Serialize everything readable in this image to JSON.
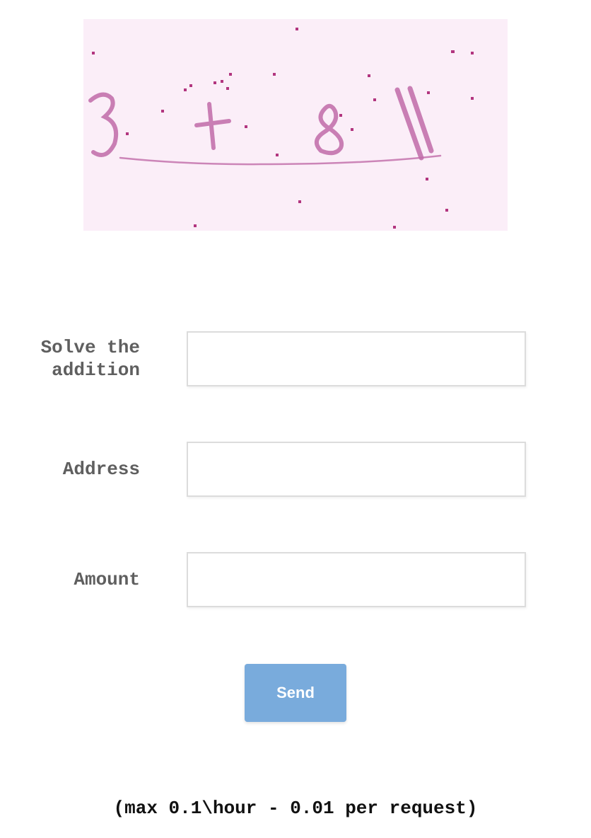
{
  "captcha": {
    "background_color": "#fbeef8",
    "ink_color": "#c06aa8",
    "dot_color": "#b2357f"
  },
  "form": {
    "captcha_label": "Solve the\naddition",
    "captcha_value": "",
    "address_label": "Address",
    "address_value": "",
    "amount_label": "Amount",
    "amount_value": "",
    "send_label": "Send",
    "button_color": "#79abdc"
  },
  "footer": {
    "note": "(max 0.1\\hour - 0.01 per request)"
  }
}
